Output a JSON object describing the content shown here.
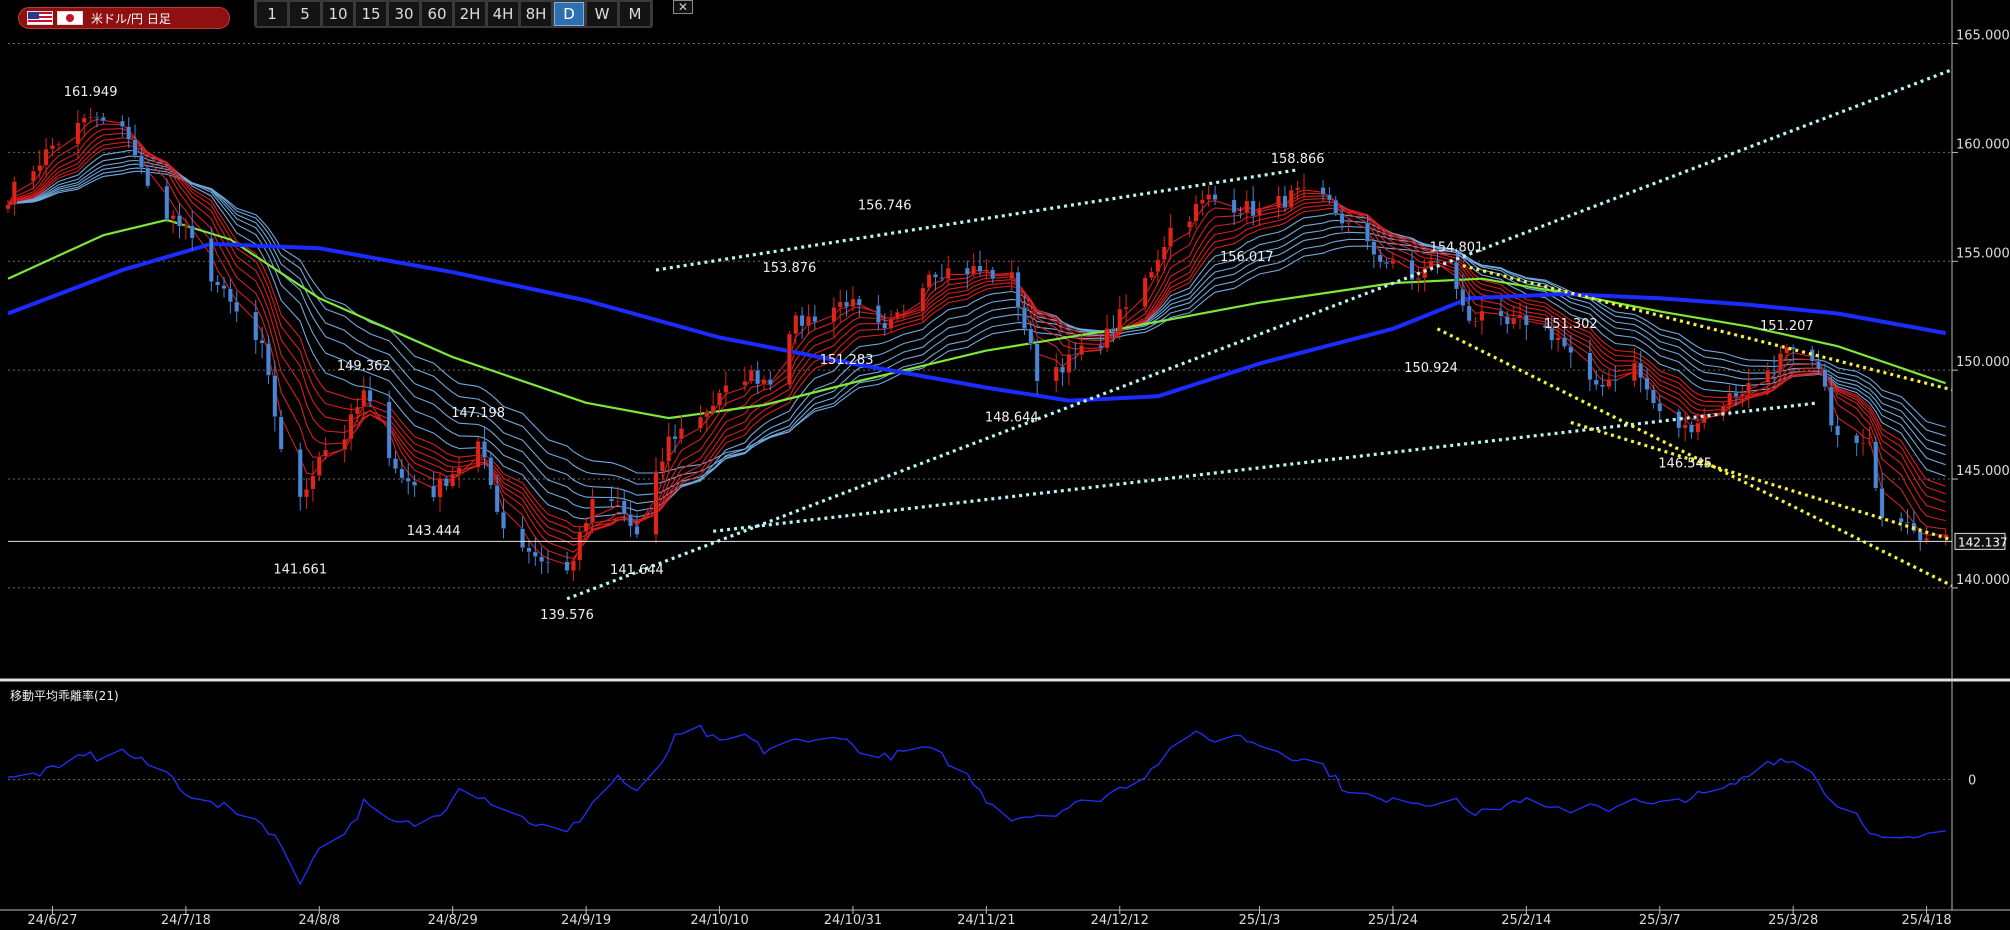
{
  "header": {
    "symbol_label": "米ドル/円 日足",
    "timeframes": [
      "1",
      "5",
      "10",
      "15",
      "30",
      "60",
      "2H",
      "4H",
      "8H",
      "D",
      "W",
      "M"
    ],
    "active_timeframe": "D",
    "close_glyph": "✕"
  },
  "colors": {
    "background": "#000000",
    "candle_up": "#e02418",
    "candle_down": "#4a86d8",
    "ma_long": "#1a2cff",
    "ma_green": "#7ee83a",
    "ma_red_ribbon": "#d61e1e",
    "ma_blue_ribbon": "#6fa8dc",
    "trend_cyan": "#b8f4f4",
    "trend_yellow": "#f2f23c",
    "deviation_line": "#2230ff"
  },
  "chart_data": [
    {
      "type": "candlestick",
      "title": "",
      "y_axis": {
        "ylim": [
          136.0,
          167.0
        ],
        "ticks": [
          "165.000",
          "160.000",
          "155.000",
          "150.000",
          "145.000",
          "140.000"
        ]
      },
      "x_axis": {
        "start": "24/6/20",
        "end": "25/4/22",
        "ticks": [
          "24/6/27",
          "24/7/18",
          "24/8/8",
          "24/8/29",
          "24/9/19",
          "24/10/10",
          "24/10/31",
          "24/11/21",
          "24/12/12",
          "25/1/3",
          "25/1/24",
          "25/2/14",
          "25/3/7",
          "25/3/28",
          "25/4/18"
        ]
      },
      "current_price": "142.137",
      "swing_labels": [
        {
          "text": "161.949",
          "date": "2024-07-03",
          "price": 161.949,
          "pos": "above"
        },
        {
          "text": "141.661",
          "date": "2024-08-05",
          "price": 141.661,
          "pos": "below"
        },
        {
          "text": "149.362",
          "date": "2024-08-15",
          "price": 149.362,
          "pos": "above"
        },
        {
          "text": "143.444",
          "date": "2024-08-26",
          "price": 143.444,
          "pos": "below"
        },
        {
          "text": "147.198",
          "date": "2024-09-02",
          "price": 147.198,
          "pos": "above"
        },
        {
          "text": "139.576",
          "date": "2024-09-16",
          "price": 139.576,
          "pos": "below"
        },
        {
          "text": "141.644",
          "date": "2024-09-27",
          "price": 141.644,
          "pos": "below"
        },
        {
          "text": "153.876",
          "date": "2024-10-21",
          "price": 153.876,
          "pos": "above"
        },
        {
          "text": "151.283",
          "date": "2024-10-30",
          "price": 151.283,
          "pos": "below"
        },
        {
          "text": "156.746",
          "date": "2024-11-05",
          "price": 156.746,
          "pos": "above"
        },
        {
          "text": "148.644",
          "date": "2024-11-25",
          "price": 148.644,
          "pos": "below"
        },
        {
          "text": "158.866",
          "date": "2025-01-09",
          "price": 158.866,
          "pos": "above"
        },
        {
          "text": "156.017",
          "date": "2025-01-01",
          "price": 156.017,
          "pos": "below"
        },
        {
          "text": "154.801",
          "date": "2025-02-03",
          "price": 154.801,
          "pos": "above"
        },
        {
          "text": "150.924",
          "date": "2025-01-30",
          "price": 150.924,
          "pos": "below"
        },
        {
          "text": "151.302",
          "date": "2025-02-21",
          "price": 151.302,
          "pos": "above"
        },
        {
          "text": "146.545",
          "date": "2025-03-11",
          "price": 146.545,
          "pos": "below"
        },
        {
          "text": "151.207",
          "date": "2025-03-27",
          "price": 151.207,
          "pos": "above"
        }
      ],
      "price_path": [
        [
          "2024-06-20",
          158.0
        ],
        [
          "2024-06-27",
          160.3
        ],
        [
          "2024-07-03",
          161.6
        ],
        [
          "2024-07-09",
          160.8
        ],
        [
          "2024-07-12",
          158.3
        ],
        [
          "2024-07-18",
          156.3
        ],
        [
          "2024-07-24",
          153.4
        ],
        [
          "2024-07-30",
          150.9
        ],
        [
          "2024-08-02",
          146.5
        ],
        [
          "2024-08-05",
          143.9
        ],
        [
          "2024-08-08",
          146.2
        ],
        [
          "2024-08-12",
          147.0
        ],
        [
          "2024-08-15",
          148.9
        ],
        [
          "2024-08-21",
          145.0
        ],
        [
          "2024-08-26",
          144.4
        ],
        [
          "2024-09-02",
          146.6
        ],
        [
          "2024-09-06",
          142.8
        ],
        [
          "2024-09-11",
          141.5
        ],
        [
          "2024-09-16",
          140.7
        ],
        [
          "2024-09-20",
          143.8
        ],
        [
          "2024-09-24",
          143.9
        ],
        [
          "2024-09-27",
          142.3
        ],
        [
          "2024-10-02",
          146.8
        ],
        [
          "2024-10-08",
          148.2
        ],
        [
          "2024-10-14",
          149.8
        ],
        [
          "2024-10-18",
          149.6
        ],
        [
          "2024-10-21",
          152.0
        ],
        [
          "2024-10-25",
          152.5
        ],
        [
          "2024-10-30",
          153.2
        ],
        [
          "2024-11-05",
          151.6
        ],
        [
          "2024-11-12",
          154.6
        ],
        [
          "2024-11-19",
          154.6
        ],
        [
          "2024-11-25",
          154.2
        ],
        [
          "2024-11-29",
          149.8
        ],
        [
          "2024-12-04",
          150.4
        ],
        [
          "2024-12-10",
          151.6
        ],
        [
          "2024-12-16",
          154.1
        ],
        [
          "2024-12-20",
          156.5
        ],
        [
          "2024-12-26",
          157.9
        ],
        [
          "2025-01-03",
          157.3
        ],
        [
          "2025-01-09",
          158.1
        ],
        [
          "2025-01-14",
          157.6
        ],
        [
          "2025-01-20",
          155.6
        ],
        [
          "2025-01-27",
          154.1
        ],
        [
          "2025-01-31",
          155.1
        ],
        [
          "2025-02-05",
          152.5
        ],
        [
          "2025-02-11",
          152.0
        ],
        [
          "2025-02-14",
          152.3
        ],
        [
          "2025-02-19",
          151.5
        ],
        [
          "2025-02-24",
          149.2
        ],
        [
          "2025-03-03",
          150.2
        ],
        [
          "2025-03-07",
          147.9
        ],
        [
          "2025-03-11",
          147.3
        ],
        [
          "2025-03-17",
          148.6
        ],
        [
          "2025-03-21",
          149.3
        ],
        [
          "2025-03-27",
          150.8
        ],
        [
          "2025-04-01",
          149.9
        ],
        [
          "2025-04-04",
          146.8
        ],
        [
          "2025-04-09",
          146.4
        ],
        [
          "2025-04-11",
          143.5
        ],
        [
          "2025-04-15",
          143.3
        ],
        [
          "2025-04-18",
          142.2
        ],
        [
          "2025-04-21",
          142.1
        ]
      ],
      "moving_averages": {
        "long_blue": [
          [
            "2024-06-20",
            152.6
          ],
          [
            "2024-07-08",
            154.6
          ],
          [
            "2024-07-22",
            155.8
          ],
          [
            "2024-08-08",
            155.6
          ],
          [
            "2024-08-29",
            154.5
          ],
          [
            "2024-09-19",
            153.2
          ],
          [
            "2024-10-10",
            151.5
          ],
          [
            "2024-10-31",
            150.3
          ],
          [
            "2024-11-21",
            149.2
          ],
          [
            "2024-12-04",
            148.6
          ],
          [
            "2024-12-18",
            148.8
          ],
          [
            "2025-01-03",
            150.3
          ],
          [
            "2025-01-24",
            151.9
          ],
          [
            "2025-02-05",
            153.3
          ],
          [
            "2025-02-20",
            153.5
          ],
          [
            "2025-03-07",
            153.3
          ],
          [
            "2025-03-21",
            153.0
          ],
          [
            "2025-04-04",
            152.6
          ],
          [
            "2025-04-21",
            151.7
          ]
        ],
        "green": [
          [
            "2024-06-20",
            154.2
          ],
          [
            "2024-07-05",
            156.2
          ],
          [
            "2024-07-15",
            156.9
          ],
          [
            "2024-07-25",
            156.0
          ],
          [
            "2024-08-08",
            153.3
          ],
          [
            "2024-08-29",
            150.6
          ],
          [
            "2024-09-19",
            148.5
          ],
          [
            "2024-10-02",
            147.8
          ],
          [
            "2024-10-17",
            148.4
          ],
          [
            "2024-11-01",
            149.5
          ],
          [
            "2024-11-21",
            150.9
          ],
          [
            "2024-12-12",
            151.9
          ],
          [
            "2025-01-03",
            153.1
          ],
          [
            "2025-01-24",
            154.0
          ],
          [
            "2025-02-07",
            154.2
          ],
          [
            "2025-02-21",
            153.5
          ],
          [
            "2025-03-07",
            152.7
          ],
          [
            "2025-03-21",
            152.0
          ],
          [
            "2025-04-04",
            151.1
          ],
          [
            "2025-04-21",
            149.4
          ]
        ]
      },
      "trendlines": [
        {
          "color": "cyan",
          "from": [
            "2024-09-16",
            139.5
          ],
          "to": [
            "2025-04-22",
            163.8
          ]
        },
        {
          "color": "cyan",
          "from": [
            "2024-09-30",
            154.6
          ],
          "to": [
            "2025-01-09",
            159.2
          ]
        },
        {
          "color": "cyan",
          "from": [
            "2024-10-09",
            142.6
          ],
          "to": [
            "2025-04-01",
            148.5
          ]
        },
        {
          "color": "yellow",
          "from": [
            "2025-02-04",
            154.8
          ],
          "to": [
            "2025-04-22",
            149.1
          ]
        },
        {
          "color": "yellow",
          "from": [
            "2025-01-31",
            151.9
          ],
          "to": [
            "2025-04-22",
            140.1
          ]
        },
        {
          "color": "yellow",
          "from": [
            "2025-02-21",
            147.6
          ],
          "to": [
            "2025-04-22",
            142.2
          ]
        }
      ]
    },
    {
      "type": "line",
      "title": "移動平均乖離率(21)",
      "ylim": [
        -7,
        5
      ],
      "zero_label": "0",
      "points": [
        [
          "2024-06-20",
          0.0
        ],
        [
          "2024-06-24",
          0.3
        ],
        [
          "2024-06-28",
          0.6
        ],
        [
          "2024-07-02",
          1.5
        ],
        [
          "2024-07-04",
          1.2
        ],
        [
          "2024-07-08",
          1.6
        ],
        [
          "2024-07-11",
          1.0
        ],
        [
          "2024-07-15",
          0.4
        ],
        [
          "2024-07-18",
          -0.7
        ],
        [
          "2024-07-22",
          -1.4
        ],
        [
          "2024-07-25",
          -1.6
        ],
        [
          "2024-07-29",
          -2.2
        ],
        [
          "2024-08-01",
          -3.1
        ],
        [
          "2024-08-03",
          -4.6
        ],
        [
          "2024-08-05",
          -5.8
        ],
        [
          "2024-08-07",
          -4.2
        ],
        [
          "2024-08-09",
          -3.6
        ],
        [
          "2024-08-13",
          -2.6
        ],
        [
          "2024-08-15",
          -1.3
        ],
        [
          "2024-08-19",
          -2.4
        ],
        [
          "2024-08-23",
          -2.5
        ],
        [
          "2024-08-27",
          -2.0
        ],
        [
          "2024-08-30",
          -0.3
        ],
        [
          "2024-09-04",
          -1.2
        ],
        [
          "2024-09-08",
          -2.0
        ],
        [
          "2024-09-12",
          -2.6
        ],
        [
          "2024-09-16",
          -3.0
        ],
        [
          "2024-09-18",
          -2.2
        ],
        [
          "2024-09-20",
          -1.3
        ],
        [
          "2024-09-24",
          0.2
        ],
        [
          "2024-09-27",
          -0.8
        ],
        [
          "2024-09-30",
          0.4
        ],
        [
          "2024-10-03",
          2.3
        ],
        [
          "2024-10-07",
          2.8
        ],
        [
          "2024-10-10",
          2.0
        ],
        [
          "2024-10-14",
          2.5
        ],
        [
          "2024-10-17",
          1.6
        ],
        [
          "2024-10-21",
          2.2
        ],
        [
          "2024-10-24",
          2.0
        ],
        [
          "2024-10-28",
          2.6
        ],
        [
          "2024-10-31",
          1.9
        ],
        [
          "2024-11-04",
          1.2
        ],
        [
          "2024-11-07",
          1.4
        ],
        [
          "2024-11-11",
          1.8
        ],
        [
          "2024-11-14",
          1.3
        ],
        [
          "2024-11-18",
          0.2
        ],
        [
          "2024-11-21",
          -1.1
        ],
        [
          "2024-11-25",
          -2.1
        ],
        [
          "2024-11-28",
          -2.0
        ],
        [
          "2024-12-02",
          -1.8
        ],
        [
          "2024-12-05",
          -1.4
        ],
        [
          "2024-12-09",
          -1.0
        ],
        [
          "2024-12-12",
          -0.5
        ],
        [
          "2024-12-16",
          0.3
        ],
        [
          "2024-12-19",
          1.4
        ],
        [
          "2024-12-23",
          2.6
        ],
        [
          "2024-12-26",
          2.2
        ],
        [
          "2024-12-30",
          2.5
        ],
        [
          "2025-01-02",
          2.1
        ],
        [
          "2025-01-06",
          1.6
        ],
        [
          "2025-01-09",
          1.2
        ],
        [
          "2025-01-13",
          0.8
        ],
        [
          "2025-01-16",
          -0.4
        ],
        [
          "2025-01-20",
          -0.9
        ],
        [
          "2025-01-23",
          -1.3
        ],
        [
          "2025-01-27",
          -1.1
        ],
        [
          "2025-01-30",
          -1.4
        ],
        [
          "2025-02-03",
          -0.9
        ],
        [
          "2025-02-06",
          -2.0
        ],
        [
          "2025-02-10",
          -1.5
        ],
        [
          "2025-02-13",
          -1.1
        ],
        [
          "2025-02-17",
          -1.6
        ],
        [
          "2025-02-20",
          -1.8
        ],
        [
          "2025-02-24",
          -1.3
        ],
        [
          "2025-02-27",
          -1.6
        ],
        [
          "2025-03-03",
          -1.2
        ],
        [
          "2025-03-06",
          -1.5
        ],
        [
          "2025-03-10",
          -1.1
        ],
        [
          "2025-03-13",
          -0.9
        ],
        [
          "2025-03-17",
          -0.6
        ],
        [
          "2025-03-20",
          0.0
        ],
        [
          "2025-03-24",
          1.0
        ],
        [
          "2025-03-27",
          1.2
        ],
        [
          "2025-03-31",
          0.4
        ],
        [
          "2025-04-03",
          -1.2
        ],
        [
          "2025-04-07",
          -1.9
        ],
        [
          "2025-04-10",
          -3.2
        ],
        [
          "2025-04-14",
          -3.4
        ],
        [
          "2025-04-17",
          -3.3
        ],
        [
          "2025-04-21",
          -2.8
        ]
      ]
    }
  ]
}
